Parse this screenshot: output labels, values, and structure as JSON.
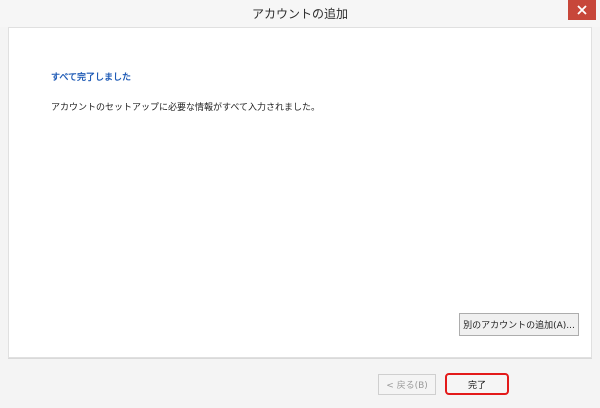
{
  "window": {
    "title": "アカウントの追加"
  },
  "content": {
    "heading": "すべて完了しました",
    "message": "アカウントのセットアップに必要な情報がすべて入力されました。"
  },
  "buttons": {
    "add_another": "別のアカウントの追加(A)...",
    "back": "< 戻る(B)",
    "finish": "完了"
  },
  "icons": {
    "close": "close-icon"
  },
  "colors": {
    "close_button": "#c7473a",
    "heading": "#1f5bb6",
    "highlight": "#e31a1a"
  }
}
